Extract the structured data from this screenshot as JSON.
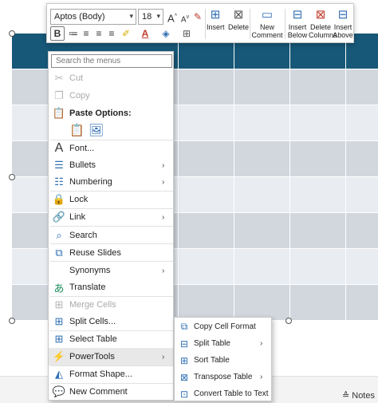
{
  "toolbar": {
    "font_name": "Aptos (Body)",
    "font_size": "18",
    "insert_label": "Insert",
    "delete_label": "Delete",
    "new_comment_label": "New Comment",
    "insert_below_label": "Insert Below",
    "delete_columns_label": "Delete Columns",
    "insert_above_label": "Insert Above",
    "bold_glyph": "B",
    "grow_font_glyph": "A",
    "shrink_font_glyph": "A",
    "font_color_glyph": "A"
  },
  "context_menu": {
    "search_placeholder": "Search the menus",
    "items": {
      "cut": "Cut",
      "copy": "Copy",
      "paste_options": "Paste Options:",
      "font": "Font...",
      "bullets": "Bullets",
      "numbering": "Numbering",
      "lock": "Lock",
      "link": "Link",
      "search": "Search",
      "reuse_slides": "Reuse Slides",
      "synonyms": "Synonyms",
      "translate": "Translate",
      "merge_cells": "Merge Cells",
      "split_cells": "Split Cells...",
      "select_table": "Select Table",
      "powertools": "PowerTools",
      "format_shape": "Format Shape...",
      "new_comment": "New Comment"
    }
  },
  "powertools_submenu": {
    "items": {
      "copy_cell_format": "Copy Cell Format",
      "split_table": "Split Table",
      "sort_table": "Sort Table",
      "transpose_table": "Transpose Table",
      "convert_table_to_text": "Convert Table to Text"
    }
  },
  "status_bar": {
    "notes_label": "Notes"
  },
  "colors": {
    "table_header": "#175878",
    "table_row": "#d2d7de",
    "table_row_alt": "#e9ecf0",
    "accent": "#2f6fb3"
  }
}
